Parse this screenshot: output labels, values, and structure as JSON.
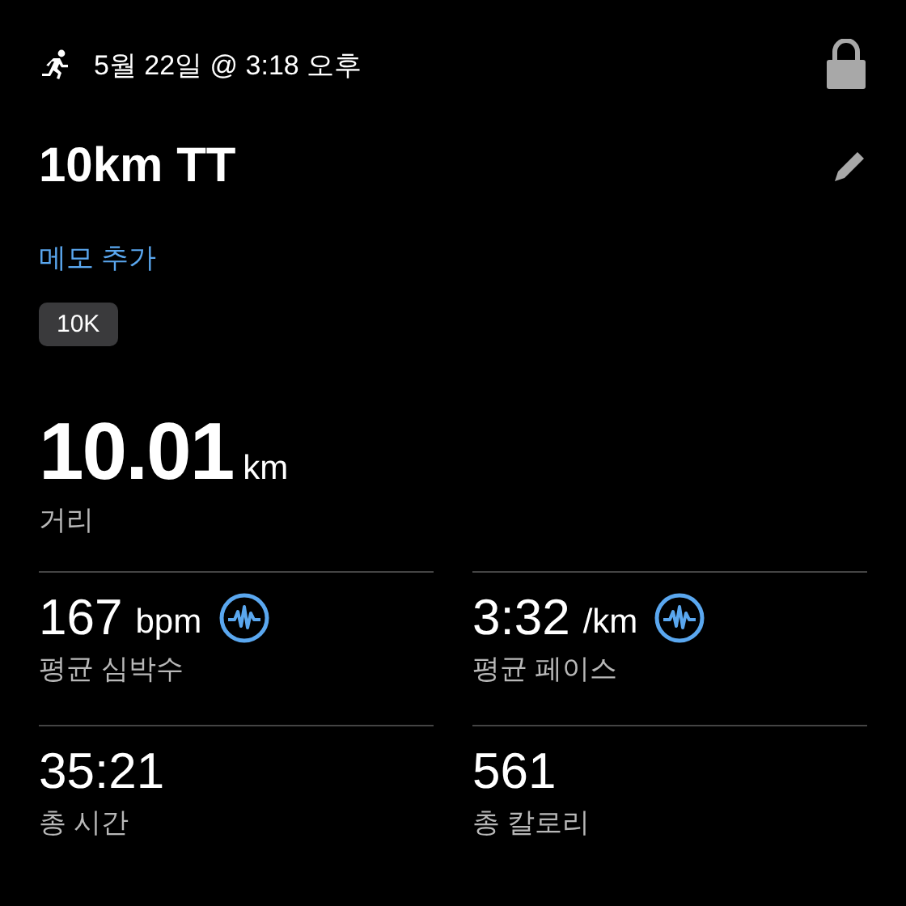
{
  "header": {
    "date": "5월 22일 @ 3:18 오후",
    "locked": true
  },
  "title": "10km TT",
  "add_note_link": "메모 추가",
  "tag": "10K",
  "distance": {
    "value": "10.01",
    "unit": "km",
    "label": "거리"
  },
  "stats": [
    {
      "value": "167",
      "unit": "bpm",
      "label": "평균 심박수",
      "graph": true
    },
    {
      "value": "3:32",
      "unit": "/km",
      "label": "평균 페이스",
      "graph": true
    },
    {
      "value": "35:21",
      "label": "총 시간",
      "graph": false
    },
    {
      "value": "561",
      "label": "총 칼로리",
      "graph": false
    }
  ]
}
